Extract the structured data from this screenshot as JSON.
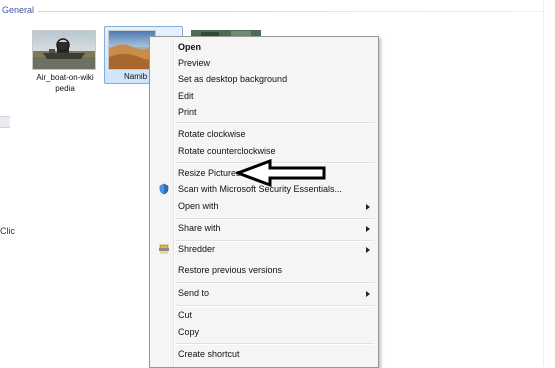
{
  "group": {
    "title": "General"
  },
  "left_strip": {
    "clipped_text": "Clic"
  },
  "thumbnails": [
    {
      "caption_line1": "Air_boat-on-wiki",
      "caption_line2": "pedia"
    },
    {
      "caption": "Namib"
    }
  ],
  "context_menu": {
    "items": {
      "open": "Open",
      "preview": "Preview",
      "set_desktop": "Set as desktop background",
      "edit": "Edit",
      "print": "Print",
      "rotate_cw": "Rotate clockwise",
      "rotate_ccw": "Rotate counterclockwise",
      "resize": "Resize Pictures",
      "scan": "Scan with Microsoft Security Essentials...",
      "open_with": "Open with",
      "share_with": "Share with",
      "shredder": "Shredder",
      "restore": "Restore previous versions",
      "send_to": "Send to",
      "cut": "Cut",
      "copy": "Copy",
      "create_shortcut": "Create shortcut"
    },
    "icons": {
      "scan": "security-essentials-shield-icon",
      "shredder": "shredder-icon",
      "submenu": "submenu-arrow-icon"
    }
  },
  "annotation": {
    "arrow": "left-pointing-arrow-annotation"
  },
  "colors": {
    "selection_bg": "#cfe4fb",
    "selection_border": "#84acdd",
    "menu_bg": "#f5f5f5",
    "menu_border": "#979797",
    "group_header_text": "#1e3a8a"
  }
}
